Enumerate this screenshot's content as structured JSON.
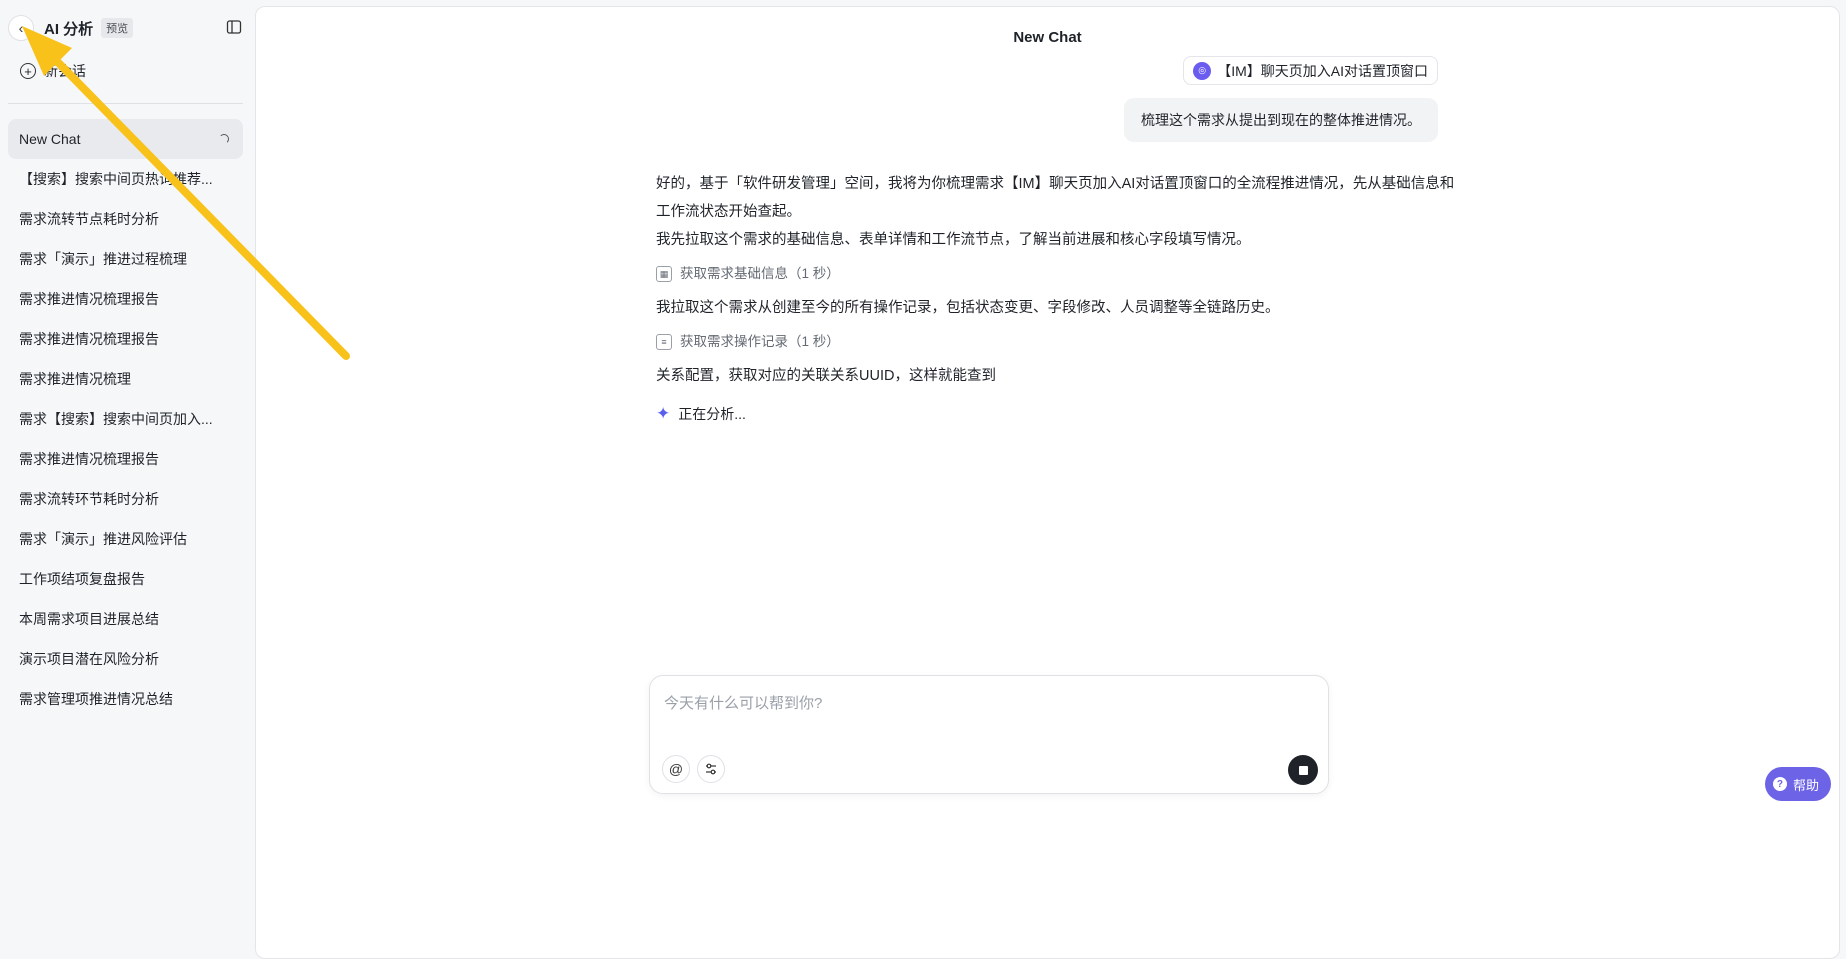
{
  "sidebar": {
    "app_title": "AI 分析",
    "badge": "预览",
    "new_chat_label": "新会话",
    "items": [
      {
        "label": "New Chat",
        "active": true
      },
      {
        "label": "【搜索】搜索中间页热词推荐..."
      },
      {
        "label": "需求流转节点耗时分析"
      },
      {
        "label": "需求「演示」推进过程梳理"
      },
      {
        "label": "需求推进情况梳理报告"
      },
      {
        "label": "需求推进情况梳理报告"
      },
      {
        "label": "需求推进情况梳理"
      },
      {
        "label": "需求【搜索】搜索中间页加入..."
      },
      {
        "label": "需求推进情况梳理报告"
      },
      {
        "label": "需求流转环节耗时分析"
      },
      {
        "label": "需求「演示」推进风险评估"
      },
      {
        "label": "工作项结项复盘报告"
      },
      {
        "label": "本周需求项目进展总结"
      },
      {
        "label": "演示项目潜在风险分析"
      },
      {
        "label": "需求管理项推进情况总结"
      }
    ]
  },
  "chat": {
    "title": "New Chat",
    "reference_chip": "【IM】聊天页加入AI对话置顶窗口",
    "user_message": "梳理这个需求从提出到现在的整体推进情况。",
    "assistant": {
      "para1": "好的，基于「软件研发管理」空间，我将为你梳理需求【IM】聊天页加入AI对话置顶窗口的全流程推进情况，先从基础信息和工作流状态开始查起。",
      "para2": "我先拉取这个需求的基础信息、表单详情和工作流节点，了解当前进展和核心字段填写情况。",
      "tool1": "获取需求基础信息（1 秒）",
      "para3": "我拉取这个需求从创建至今的所有操作记录，包括状态变更、字段修改、人员调整等全链路历史。",
      "tool2": "获取需求操作记录（1 秒）",
      "para4": "关系配置，获取对应的关联关系UUID，这样就能查到",
      "status": "正在分析..."
    }
  },
  "input": {
    "placeholder": "今天有什么可以帮到你?"
  },
  "help": {
    "label": "帮助"
  },
  "colors": {
    "accent": "#6c63e6",
    "annotation_arrow": "#f8c21a"
  }
}
